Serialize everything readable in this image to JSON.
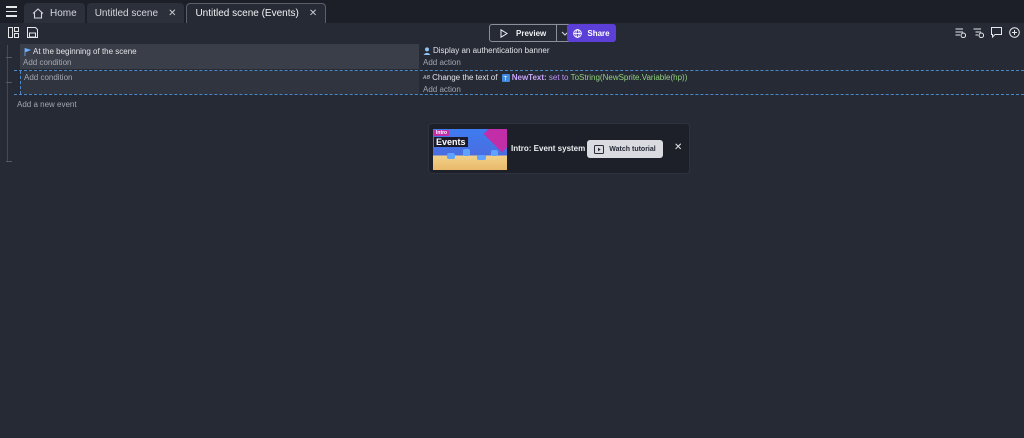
{
  "tabs": [
    {
      "label": "Home"
    },
    {
      "label": "Untitled scene"
    },
    {
      "label": "Untitled scene (Events)"
    }
  ],
  "toolbar": {
    "preview_label": "Preview",
    "share_label": "Share"
  },
  "events": [
    {
      "condition": "At the beginning of the scene",
      "add_condition": "Add condition",
      "action": "Display an authentication banner",
      "add_action": "Add action"
    },
    {
      "add_condition": "Add condition",
      "action_prefix": "Change the text of",
      "action_object": "NewText:",
      "action_keyword": "set to",
      "action_expression": "ToString(NewSprite.Variable(hp))",
      "add_action": "Add action"
    }
  ],
  "add_event_label": "Add a new event",
  "tutorial": {
    "thumb_intro": "Intro",
    "thumb_events": "Events",
    "title": "Intro: Event system",
    "watch_label": "Watch tutorial"
  },
  "colors": {
    "accent_purple": "#5b3fd6",
    "background": "#262a35",
    "selection_blue": "#4c88c9"
  }
}
